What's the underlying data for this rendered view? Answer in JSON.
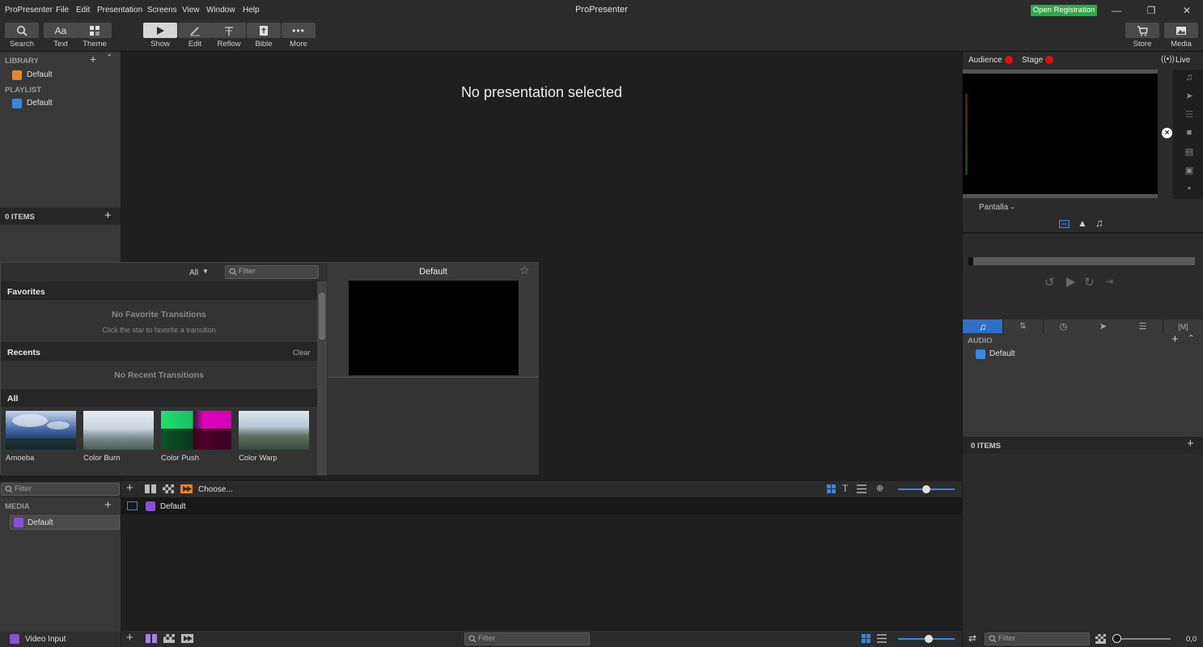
{
  "app": {
    "menu": [
      "ProPresenter",
      "File",
      "Edit",
      "Presentation",
      "Screens",
      "View",
      "Window",
      "Help"
    ],
    "title": "ProPresenter",
    "register_label": "Open Registration"
  },
  "toolbar": {
    "left": [
      "Search",
      "Text",
      "Theme"
    ],
    "modes": [
      "Show",
      "Edit",
      "Reflow",
      "Bible",
      "More"
    ],
    "right": [
      "Store",
      "Media"
    ]
  },
  "library": {
    "header": "LIBRARY",
    "item": "Default",
    "playlist_header": "PLAYLIST",
    "playlist_item": "Default",
    "items_count": "0 ITEMS"
  },
  "main": {
    "empty_message": "No presentation selected"
  },
  "transitions": {
    "dropdown": "All",
    "filter_placeholder": "Filter",
    "favorites_header": "Favorites",
    "favorites_empty": "No Favorite Transitions",
    "favorites_hint": "Click the star to favorite a transition",
    "recents_header": "Recents",
    "clear_label": "Clear",
    "recents_empty": "No Recent Transitions",
    "all_header": "All",
    "items": [
      "Amoeba",
      "Color Burn",
      "Color Push",
      "Color Warp"
    ],
    "preview_title": "Default"
  },
  "bottom": {
    "filter_placeholder": "Filter",
    "choose_label": "Choose...",
    "media_header": "MEDIA",
    "media_item": "Default",
    "playlist_row": "Default",
    "video_input": "Video Input",
    "filter_center": "Filter"
  },
  "right": {
    "audience_label": "Audience",
    "stage_label": "Stage",
    "live_label": "Live",
    "screen_select": "Pantalla",
    "audio_header": "AUDIO",
    "audio_item": "Default",
    "items_count": "0 ITEMS",
    "filter_placeholder": "Filter",
    "volume_value": "0,0"
  },
  "colors": {
    "accent_blue": "#2f6fc6",
    "record_red": "#e01010",
    "register_green": "#2ea84a",
    "orange": "#e8842a",
    "purple": "#8a4fd6"
  }
}
